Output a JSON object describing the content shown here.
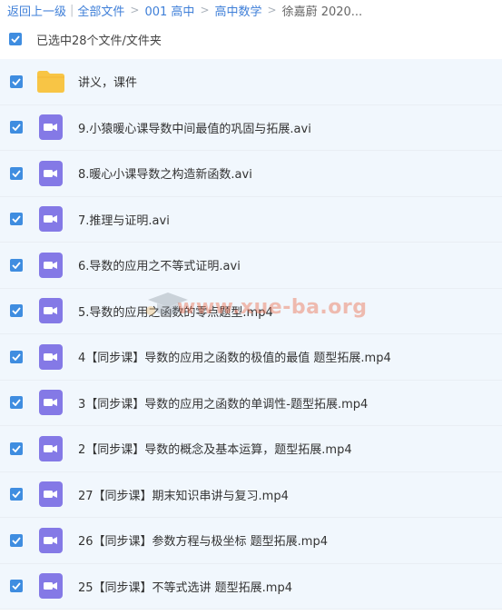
{
  "breadcrumb": {
    "back": "返回上一级",
    "items": [
      "全部文件",
      "001 高中",
      "高中数学",
      "徐嘉蔚 2020..."
    ]
  },
  "selection": {
    "label": "已选中28个文件/文件夹"
  },
  "files": [
    {
      "name": "讲义，课件",
      "type": "folder"
    },
    {
      "name": "9.小猿暖心课导数中间最值的巩固与拓展.avi",
      "type": "video"
    },
    {
      "name": "8.暖心小课导数之构造新函数.avi",
      "type": "video"
    },
    {
      "name": "7.推理与证明.avi",
      "type": "video"
    },
    {
      "name": "6.导数的应用之不等式证明.avi",
      "type": "video"
    },
    {
      "name": "5.导数的应用之函数的零点题型.mp4",
      "type": "video"
    },
    {
      "name": "4【同步课】导数的应用之函数的极值的最值 题型拓展.mp4",
      "type": "video"
    },
    {
      "name": "3【同步课】导数的应用之函数的单调性-题型拓展.mp4",
      "type": "video"
    },
    {
      "name": "2【同步课】导数的概念及基本运算，题型拓展.mp4",
      "type": "video"
    },
    {
      "name": "27【同步课】期末知识串讲与复习.mp4",
      "type": "video"
    },
    {
      "name": "26【同步课】参数方程与极坐标 题型拓展.mp4",
      "type": "video"
    },
    {
      "name": "25【同步课】不等式选讲 题型拓展.mp4",
      "type": "video"
    }
  ],
  "watermark": {
    "text": "www.xue-ba.org"
  },
  "colors": {
    "link": "#3f7fd8",
    "checkbox": "#3f8de0",
    "row_bg": "#f1f7fd",
    "video_icon": "#8479e6",
    "folder_icon": "#f8c545"
  }
}
